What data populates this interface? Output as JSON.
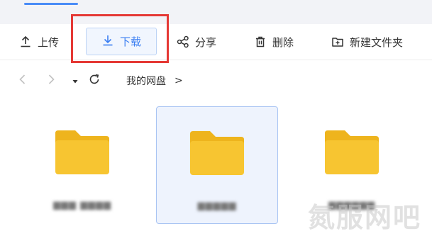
{
  "toolbar": {
    "upload_label": "上传",
    "download_label": "下载",
    "share_label": "分享",
    "delete_label": "删除",
    "new_folder_label": "新建文件夹"
  },
  "nav": {
    "breadcrumb_root": "我的网盘",
    "breadcrumb_separator": ">"
  },
  "files": [
    {
      "name": "▆▆▆ ▆▆▆▆",
      "selected": false
    },
    {
      "name": "▆▆▆▆▆",
      "selected": true
    },
    {
      "name": "▆▆▆▆▆▆",
      "selected": false
    }
  ],
  "watermark": "氮服网吧",
  "colors": {
    "accent": "#3b7ff2",
    "highlight_red": "#e53935",
    "folder_yellow": "#f7c531",
    "folder_tab": "#eeb41d"
  },
  "icons": {
    "upload": "upload-icon",
    "download": "download-icon",
    "share": "share-icon",
    "delete": "trash-icon",
    "new_folder": "folder-plus-icon"
  }
}
